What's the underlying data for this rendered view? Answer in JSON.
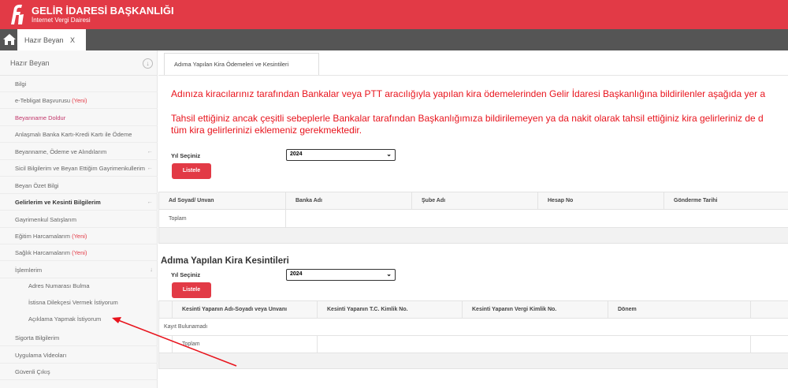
{
  "header": {
    "title": "GELİR İDARESİ BAŞKANLIĞI",
    "subtitle": "İnternet Vergi Dairesi",
    "color": "#e23a46"
  },
  "page_tab": {
    "label": "Hazır Beyan",
    "close": "X"
  },
  "sidebar": {
    "title": "Hazır Beyan",
    "items": [
      {
        "label": "Bilgi"
      },
      {
        "label": "e-Tebligat Başvurusu",
        "badge": "(Yeni)"
      },
      {
        "label": "Beyanname Doldur"
      },
      {
        "label": "Anlaşmalı Banka Kartı-Kredi Kartı ile Ödeme"
      },
      {
        "label": "Beyanname, Ödeme ve Alındılarım",
        "arrow": "←"
      },
      {
        "label": "Sicil Bilgilerim ve Beyan Ettiğim Gayrimenkullerim",
        "arrow": "←"
      },
      {
        "label": "Beyan Özet Bilgi"
      },
      {
        "label": "Gelirlerim ve Kesinti Bilgilerim",
        "arrow": "←"
      },
      {
        "label": "Gayrimenkul Satışlarım"
      },
      {
        "label": "Eğitim Harcamalarım",
        "badge": "(Yeni)"
      },
      {
        "label": "Sağlık Harcamalarım",
        "badge": "(Yeni)"
      },
      {
        "label": "İşlemlerim",
        "arrow": "↓"
      },
      {
        "label": "Adres Numarası Bulma"
      },
      {
        "label": "İstisna Dilekçesi Vermek İstiyorum"
      },
      {
        "label": "Açıklama Yapmak İstiyorum"
      },
      {
        "label": "Sigorta Bilgilerim"
      },
      {
        "label": "Uygulama Videoları"
      },
      {
        "label": "Güvenli Çıkış"
      }
    ]
  },
  "main": {
    "tab": "Adıma Yapılan Kira Ödemeleri ve Kesintileri",
    "notice1": "Adınıza kiracılarınız tarafından Bankalar veya PTT aracılığıyla yapılan kira ödemelerinden Gelir İdaresi Başkanlığına bildirilenler aşağıda yer a",
    "notice2a": "Tahsil ettiğiniz ancak çeşitli sebeplerle Bankalar tarafından Başkanlığımıza bildirilemeyen ya da nakit olarak tahsil ettiğiniz kira gelirleriniz de d",
    "notice2b": "tüm kira gelirlerinizi eklemeniz gerekmektedir.",
    "payments": {
      "year_label": "Yıl Seçiniz",
      "year": "2024",
      "button": "Listele",
      "columns": [
        "Ad Soyad/ Unvan",
        "Banka Adı",
        "Şube Adı",
        "Hesap No",
        "Gönderme Tarihi"
      ],
      "total": "Toplam"
    },
    "deductions": {
      "title": "Adıma Yapılan Kira Kesintileri",
      "year_label": "Yıl Seçiniz",
      "year": "2024",
      "button": "Listele",
      "columns": [
        "Kesinti Yapanın Adı-Soyadı veya Unvanı",
        "Kesinti Yapanın T.C. Kimlik No.",
        "Kesinti Yapanın Vergi Kimlik No.",
        "Dönem"
      ],
      "empty": "Kayıt Bulunamadı",
      "total": "Toplam"
    }
  },
  "annotation": {
    "color": "#e8141d"
  }
}
